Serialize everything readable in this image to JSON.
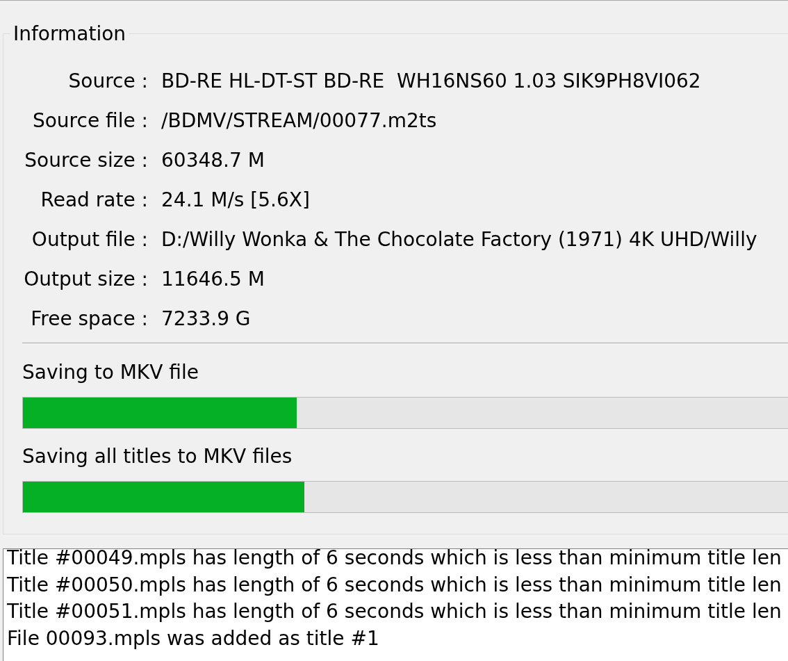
{
  "information": {
    "title": "Information",
    "rows": [
      {
        "label": "Source :",
        "value": "BD-RE HL-DT-ST BD-RE  WH16NS60 1.03 SIK9PH8VI062"
      },
      {
        "label": "Source file :",
        "value": "/BDMV/STREAM/00077.m2ts"
      },
      {
        "label": "Source size :",
        "value": "60348.7 M"
      },
      {
        "label": "Read rate :",
        "value": "24.1 M/s [5.6X]"
      },
      {
        "label": "Output file :",
        "value": "D:/Willy Wonka & The Chocolate Factory (1971) 4K UHD/Willy"
      },
      {
        "label": "Output size :",
        "value": "11646.5 M"
      },
      {
        "label": "Free space :",
        "value": "7233.9 G"
      }
    ]
  },
  "progress": [
    {
      "label": "Saving to MKV file",
      "level": 0.358
    },
    {
      "label": "Saving all titles to MKV files",
      "level": 0.368
    }
  ],
  "log": {
    "lines": [
      "Title #00049.mpls has length of 6 seconds which is less than minimum title len",
      "Title #00050.mpls has length of 6 seconds which is less than minimum title len",
      "Title #00051.mpls has length of 6 seconds which is less than minimum title len",
      "File 00093.mpls was added as title #1"
    ]
  }
}
